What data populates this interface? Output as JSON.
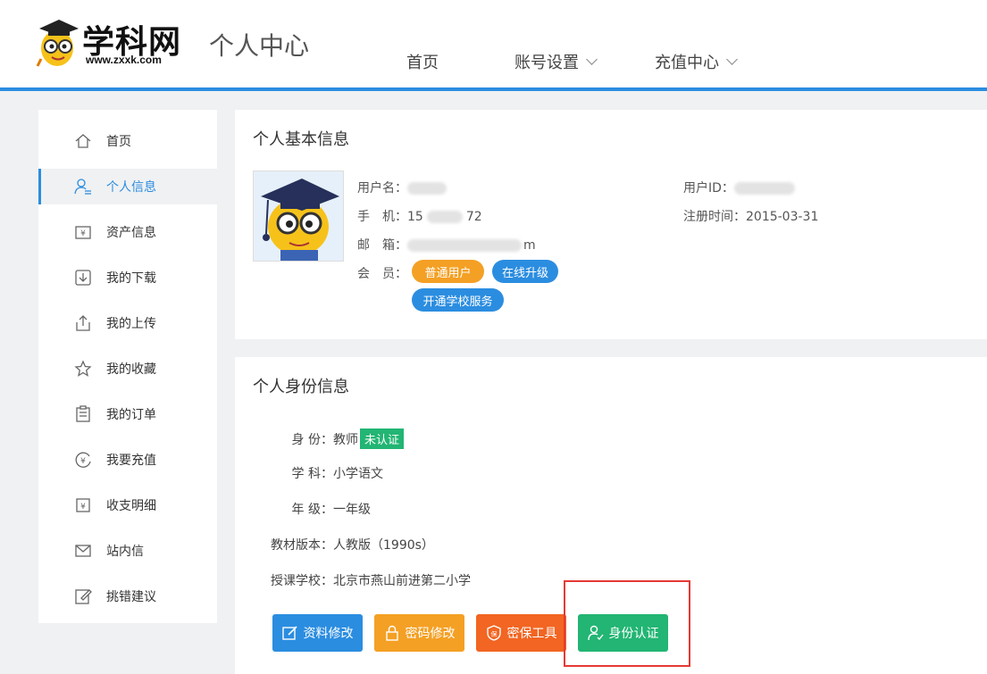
{
  "header": {
    "logo_text": "学科网",
    "logo_url": "www.zxxk.com",
    "page_title": "个人中心",
    "nav": [
      {
        "label": "首页"
      },
      {
        "label": "账号设置"
      },
      {
        "label": "充值中心"
      }
    ],
    "accent": "#2b8de0"
  },
  "sidebar": {
    "items": [
      {
        "label": "首页",
        "icon": "home-icon"
      },
      {
        "label": "个人信息",
        "icon": "user-icon",
        "active": true
      },
      {
        "label": "资产信息",
        "icon": "wallet-icon"
      },
      {
        "label": "我的下载",
        "icon": "download-icon"
      },
      {
        "label": "我的上传",
        "icon": "upload-icon"
      },
      {
        "label": "我的收藏",
        "icon": "star-icon"
      },
      {
        "label": "我的订单",
        "icon": "order-icon"
      },
      {
        "label": "我要充值",
        "icon": "recharge-icon"
      },
      {
        "label": "收支明细",
        "icon": "ledger-icon"
      },
      {
        "label": "站内信",
        "icon": "mail-icon"
      },
      {
        "label": "挑错建议",
        "icon": "edit-icon"
      }
    ]
  },
  "basic_info": {
    "title": "个人基本信息",
    "username_label": "用户名：",
    "phone_label": "手　机：",
    "phone_value_start": "15",
    "phone_value_end": "72",
    "email_label": "邮　箱：",
    "email_value_end": "m",
    "member_label": "会　员：",
    "userid_label": "用户ID：",
    "regtime_label": "注册时间：",
    "regtime_value": "2015-03-31",
    "tags": {
      "member_level": "普通用户",
      "upgrade": "在线升级",
      "school_service": "开通学校服务"
    }
  },
  "identity_info": {
    "title": "个人身份信息",
    "rows": [
      {
        "key": "身 份：",
        "value": "教师",
        "badge": "未认证"
      },
      {
        "key": "学 科：",
        "value": "小学语文"
      },
      {
        "key": "年 级：",
        "value": "一年级"
      },
      {
        "key": "教材版本：",
        "value": "人教版（1990s）"
      },
      {
        "key": "授课学校：",
        "value": "北京市燕山前进第二小学"
      }
    ],
    "buttons": {
      "edit_profile": "资料修改",
      "change_password": "密码修改",
      "security_tool": "密保工具",
      "identity_verify": "身份认证"
    }
  }
}
